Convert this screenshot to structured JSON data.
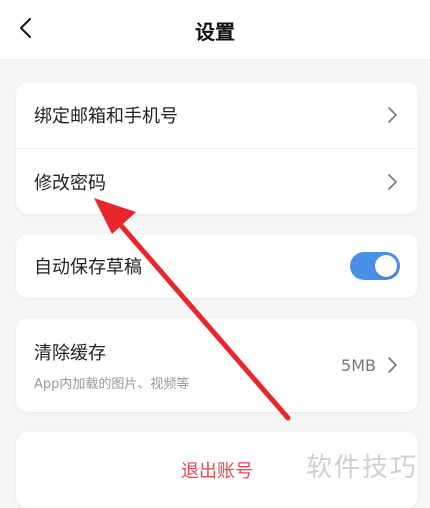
{
  "header": {
    "title": "设置",
    "back_icon": "chevron-left-icon"
  },
  "account_section": {
    "items": [
      {
        "label": "绑定邮箱和手机号",
        "icon": "chevron-right-icon"
      },
      {
        "label": "修改密码",
        "icon": "chevron-right-icon"
      }
    ]
  },
  "autosave": {
    "label": "自动保存草稿",
    "enabled": true,
    "toggle_color": "#4a8fe8"
  },
  "cache": {
    "title": "清除缓存",
    "subtitle": "App内加载的图片、视频等",
    "size": "5MB",
    "icon": "chevron-right-icon"
  },
  "logout": {
    "label": "退出账号",
    "color": "#e5484d"
  },
  "watermark": {
    "text": "软件技巧"
  },
  "annotation": {
    "arrow_color": "#e8262b"
  }
}
